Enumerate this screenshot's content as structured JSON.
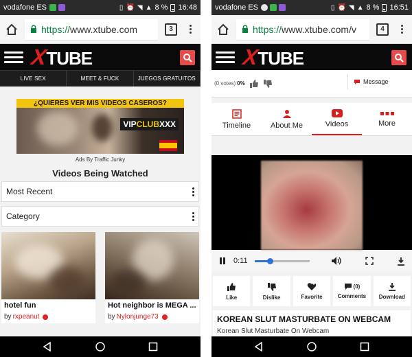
{
  "left": {
    "status": {
      "carrier": "vodafone ES",
      "battery": "8 %",
      "time": "16:48"
    },
    "browser": {
      "url_proto": "https://",
      "url_rest": "www.xtube.com",
      "tab_count": "3"
    },
    "site": {
      "logo_x": "X",
      "logo_rest": "TUBE"
    },
    "nav": [
      "LIVE SEX",
      "MEET & FUCK",
      "JUEGOS GRATUITOS"
    ],
    "ad": {
      "headline": "¿QUIERES VER MIS VIDEOS CASEROS?",
      "badge_vip": "VIP",
      "badge_club": "CLUB",
      "badge_xxx": "XXX",
      "ads_by": "Ads By Traffic Junky"
    },
    "section_title": "Videos Being Watched",
    "sort_label": "Most Recent",
    "category_label": "Category",
    "videos": [
      {
        "title": "hotel fun",
        "by": "by",
        "user": "rxpeanut"
      },
      {
        "title": "Hot neighbor is MEGA ...",
        "by": "by",
        "user": "Nylonjunge73"
      }
    ]
  },
  "right": {
    "status": {
      "carrier": "vodafone ES",
      "battery": "8 %",
      "time": "16:51"
    },
    "browser": {
      "url_proto": "https://",
      "url_rest": "www.xtube.com/v",
      "tab_count": "4"
    },
    "site": {
      "logo_x": "X",
      "logo_rest": "TUBE"
    },
    "votes": {
      "label": "(0 votes)",
      "pct": "0%"
    },
    "message_label": "Message",
    "tabs": [
      "Timeline",
      "About Me",
      "Videos",
      "More"
    ],
    "player": {
      "time": "0:11",
      "progress": 0.28
    },
    "actions": {
      "like": "Like",
      "dislike": "Dislike",
      "favorite": "Favorite",
      "comments": "Comments",
      "comments_count": "(0)",
      "download": "Download"
    },
    "video_title": "KOREAN SLUT MASTURBATE ON WEBCAM",
    "video_subtitle": "Korean Slut Masturbate On Webcam"
  },
  "colors": {
    "brand_red": "#d9201d",
    "header_black": "#0a0a0a",
    "url_green": "#0b8043",
    "player_blue": "#2b73d6"
  },
  "icons": [
    "home-icon",
    "lock-icon",
    "tabs-icon",
    "overflow-menu-icon",
    "hamburger-icon",
    "search-icon",
    "back-icon",
    "home-circle-icon",
    "recents-icon",
    "thumbs-up-icon",
    "thumbs-down-icon",
    "message-icon",
    "timeline-icon",
    "person-icon",
    "youtube-play-icon",
    "more-grid-icon",
    "pause-icon",
    "volume-icon",
    "fullscreen-icon",
    "download-icon",
    "favorite-heart-icon",
    "comments-icon"
  ]
}
